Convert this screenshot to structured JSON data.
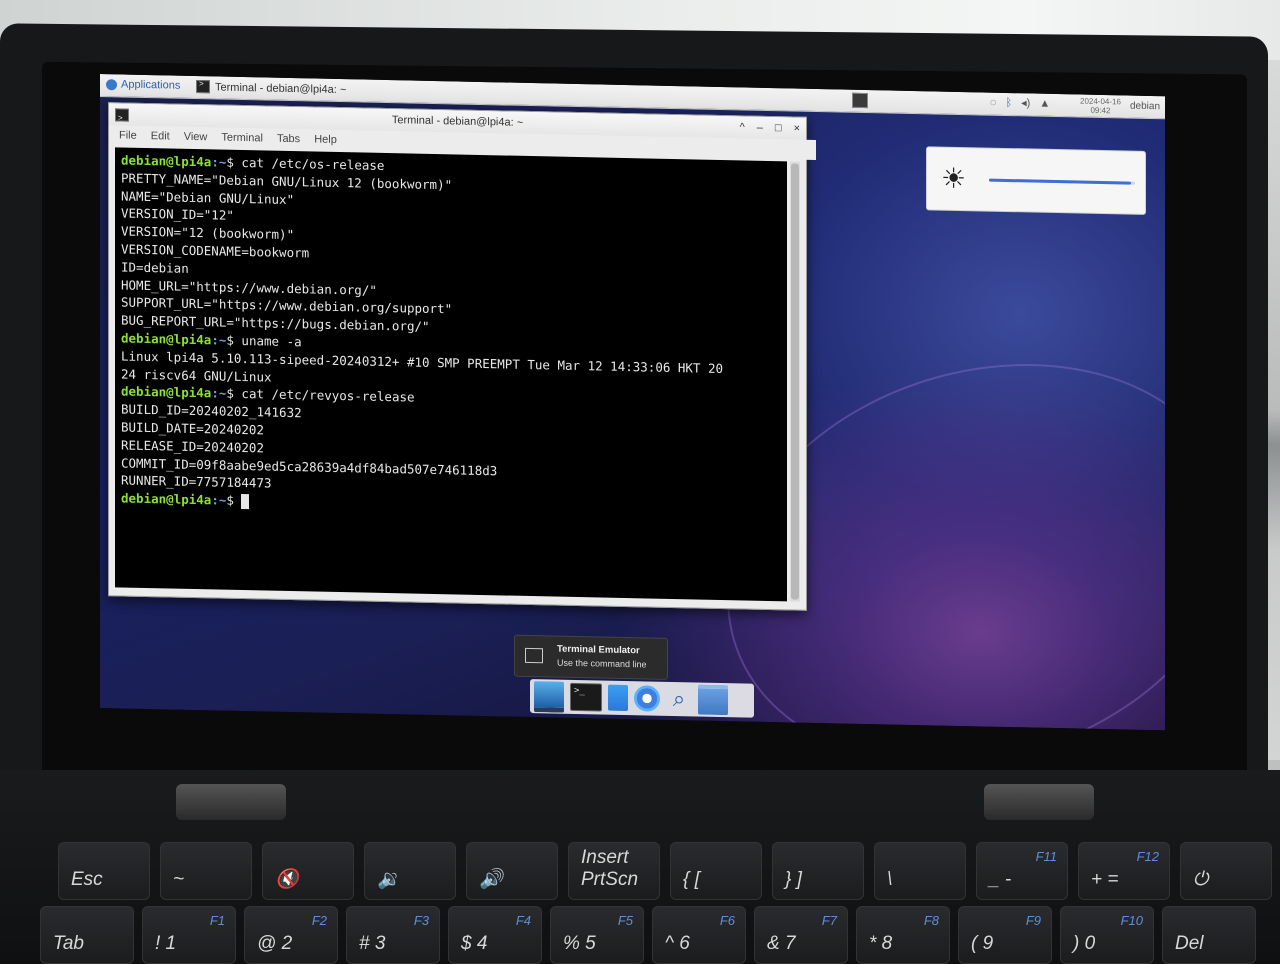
{
  "panel": {
    "applications": "Applications",
    "task_title": "Terminal - debian@lpi4a: ~",
    "clock_date": "2024-04-16",
    "clock_time": "09:42",
    "user": "debian"
  },
  "window": {
    "title": "Terminal - debian@lpi4a: ~",
    "controls": [
      "^",
      "–",
      "□",
      "×"
    ],
    "menu": [
      "File",
      "Edit",
      "View",
      "Terminal",
      "Tabs",
      "Help"
    ]
  },
  "terminal": {
    "prompt_user": "debian@lpi4a",
    "prompt_path": ":~",
    "prompt_symbol": "$",
    "lines": [
      {
        "type": "cmd",
        "text": " cat /etc/os-release"
      },
      {
        "type": "out",
        "text": "PRETTY_NAME=\"Debian GNU/Linux 12 (bookworm)\""
      },
      {
        "type": "out",
        "text": "NAME=\"Debian GNU/Linux\""
      },
      {
        "type": "out",
        "text": "VERSION_ID=\"12\""
      },
      {
        "type": "out",
        "text": "VERSION=\"12 (bookworm)\""
      },
      {
        "type": "out",
        "text": "VERSION_CODENAME=bookworm"
      },
      {
        "type": "out",
        "text": "ID=debian"
      },
      {
        "type": "out",
        "text": "HOME_URL=\"https://www.debian.org/\""
      },
      {
        "type": "out",
        "text": "SUPPORT_URL=\"https://www.debian.org/support\""
      },
      {
        "type": "out",
        "text": "BUG_REPORT_URL=\"https://bugs.debian.org/\""
      },
      {
        "type": "cmd",
        "text": " uname -a"
      },
      {
        "type": "out",
        "text": "Linux lpi4a 5.10.113-sipeed-20240312+ #10 SMP PREEMPT Tue Mar 12 14:33:06 HKT 20"
      },
      {
        "type": "out",
        "text": "24 riscv64 GNU/Linux"
      },
      {
        "type": "cmd",
        "text": " cat /etc/revyos-release"
      },
      {
        "type": "out",
        "text": "BUILD_ID=20240202_141632"
      },
      {
        "type": "out",
        "text": "BUILD_DATE=20240202"
      },
      {
        "type": "out",
        "text": "RELEASE_ID=20240202"
      },
      {
        "type": "out",
        "text": "COMMIT_ID=09f8aabe9ed5ca28639a4df84bad507e746118d3"
      },
      {
        "type": "out",
        "text": "RUNNER_ID=7757184473"
      },
      {
        "type": "prompt",
        "text": " "
      }
    ]
  },
  "brightness": {
    "level": 0.97,
    "icon": "sun-icon"
  },
  "tooltip": {
    "title": "Terminal Emulator",
    "subtitle": "Use the command line"
  },
  "dock": [
    "desktop-icon",
    "terminal-icon",
    "text-editor-icon",
    "web-browser-icon",
    "app-finder-icon",
    "file-manager-icon"
  ],
  "keyboard": {
    "row1": [
      {
        "main": "Esc",
        "fn": ""
      },
      {
        "main": "~",
        "fn": ""
      },
      {
        "main": "🔇",
        "fn": ""
      },
      {
        "main": "🔉",
        "fn": ""
      },
      {
        "main": "🔊",
        "fn": ""
      },
      {
        "main": "Insert PrtScn",
        "fn": ""
      },
      {
        "main": "{ [",
        "fn": ""
      },
      {
        "main": "} ]",
        "fn": ""
      },
      {
        "main": "\\",
        "fn": ""
      },
      {
        "main": "_ -",
        "fn": "F11"
      },
      {
        "main": "+ =",
        "fn": "F12"
      },
      {
        "main": "⏻",
        "fn": ""
      }
    ],
    "row2": [
      {
        "main": "Tab",
        "fn": ""
      },
      {
        "main": "! 1",
        "fn": "F1"
      },
      {
        "main": "@ 2",
        "fn": "F2"
      },
      {
        "main": "# 3",
        "fn": "F3"
      },
      {
        "main": "$ 4",
        "fn": "F4"
      },
      {
        "main": "% 5",
        "fn": "F5"
      },
      {
        "main": "^ 6",
        "fn": "F6"
      },
      {
        "main": "& 7",
        "fn": "F7"
      },
      {
        "main": "* 8",
        "fn": "F8"
      },
      {
        "main": "( 9",
        "fn": "F9"
      },
      {
        "main": ") 0",
        "fn": "F10"
      },
      {
        "main": "Del",
        "fn": ""
      }
    ]
  }
}
